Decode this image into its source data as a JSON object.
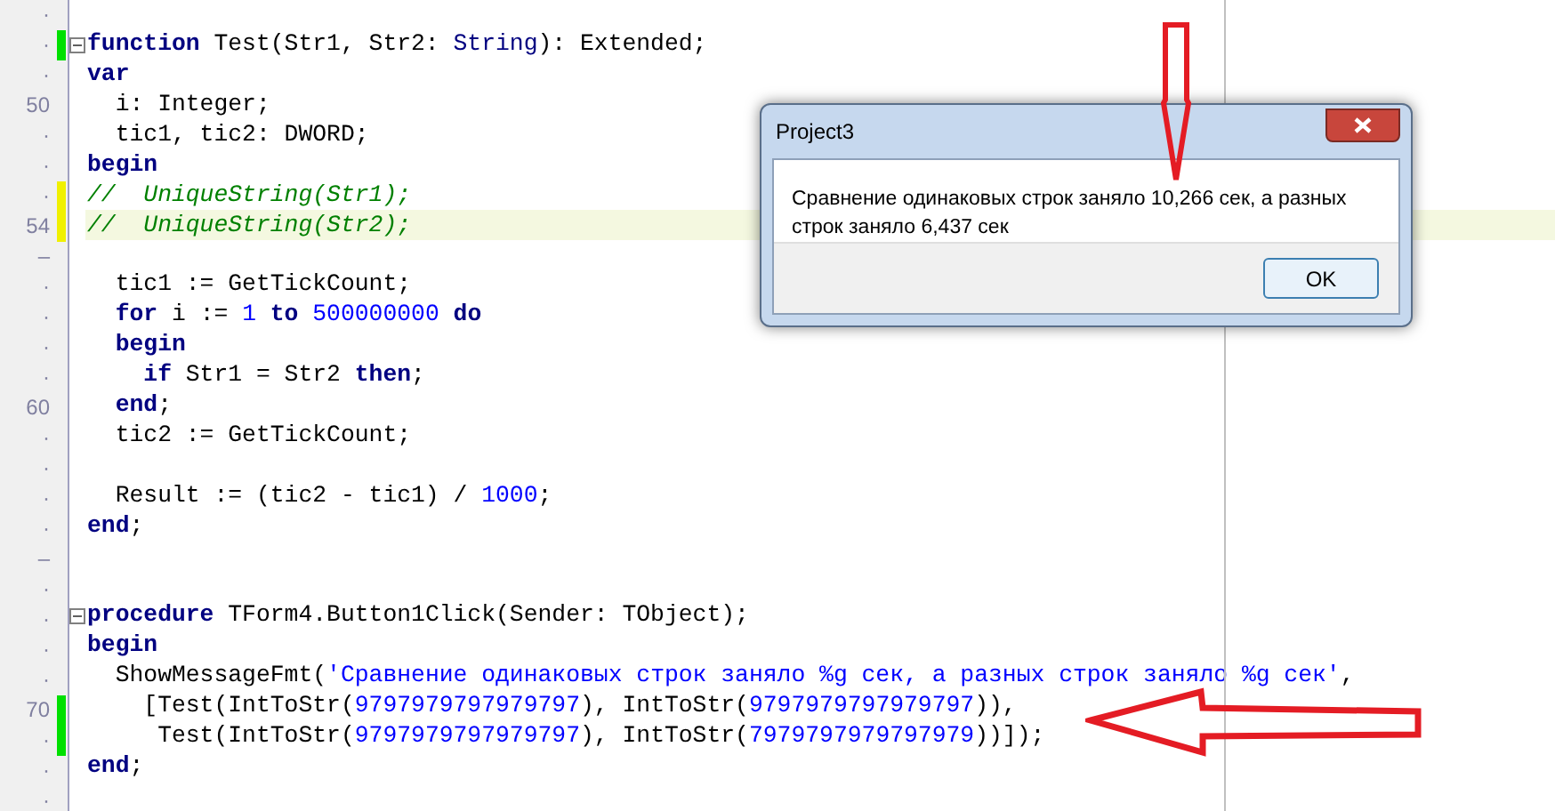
{
  "editor": {
    "lines": [
      {
        "gutter": "·",
        "fold": false,
        "current": false
      },
      {
        "gutter": "·",
        "color": "#00e000",
        "fold": true,
        "current": false,
        "tokens": [
          {
            "kind": "keyword",
            "t": "function"
          },
          {
            "kind": "plain",
            "t": " Test(Str1, Str2: "
          },
          {
            "kind": "type",
            "t": "String"
          },
          {
            "kind": "plain",
            "t": "): Extended;"
          }
        ]
      },
      {
        "gutter": "·",
        "fold": false,
        "current": false,
        "tokens": [
          {
            "kind": "keyword",
            "t": "var"
          }
        ]
      },
      {
        "gutter": "50",
        "fold": false,
        "current": false,
        "tokens": [
          {
            "kind": "plain",
            "t": "  i: Integer;"
          }
        ]
      },
      {
        "gutter": "·",
        "fold": false,
        "current": false,
        "tokens": [
          {
            "kind": "plain",
            "t": "  tic1, tic2: DWORD;"
          }
        ]
      },
      {
        "gutter": "·",
        "fold": false,
        "current": false,
        "tokens": [
          {
            "kind": "keyword",
            "t": "begin"
          }
        ]
      },
      {
        "gutter": "·",
        "color": "#f0f000",
        "fold": false,
        "current": false,
        "tokens": [
          {
            "kind": "comment",
            "t": "//  UniqueString(Str1);"
          }
        ]
      },
      {
        "gutter": "54",
        "color": "#f0f000",
        "fold": false,
        "current": true,
        "tokens": [
          {
            "kind": "comment",
            "t": "//  UniqueString(Str2);"
          }
        ]
      },
      {
        "gutter": "–",
        "fold": false,
        "current": false
      },
      {
        "gutter": "·",
        "fold": false,
        "current": false,
        "tokens": [
          {
            "kind": "plain",
            "t": "  tic1 := GetTickCount;"
          }
        ]
      },
      {
        "gutter": "·",
        "fold": false,
        "current": false,
        "tokens": [
          {
            "kind": "keyword",
            "t": "  for"
          },
          {
            "kind": "plain",
            "t": " i := "
          },
          {
            "kind": "number",
            "t": "1"
          },
          {
            "kind": "keyword",
            "t": " to "
          },
          {
            "kind": "number",
            "t": "500000000"
          },
          {
            "kind": "keyword",
            "t": " do"
          }
        ]
      },
      {
        "gutter": "·",
        "fold": false,
        "current": false,
        "tokens": [
          {
            "kind": "keyword",
            "t": "  begin"
          }
        ]
      },
      {
        "gutter": "·",
        "fold": false,
        "current": false,
        "tokens": [
          {
            "kind": "keyword",
            "t": "    if"
          },
          {
            "kind": "plain",
            "t": " Str1 = Str2 "
          },
          {
            "kind": "keyword",
            "t": "then"
          },
          {
            "kind": "plain",
            "t": ";"
          }
        ]
      },
      {
        "gutter": "60",
        "fold": false,
        "current": false,
        "tokens": [
          {
            "kind": "keyword",
            "t": "  end"
          },
          {
            "kind": "plain",
            "t": ";"
          }
        ]
      },
      {
        "gutter": "·",
        "fold": false,
        "current": false,
        "tokens": [
          {
            "kind": "plain",
            "t": "  tic2 := GetTickCount;"
          }
        ]
      },
      {
        "gutter": "·",
        "fold": false,
        "current": false
      },
      {
        "gutter": "·",
        "fold": false,
        "current": false,
        "tokens": [
          {
            "kind": "plain",
            "t": "  Result := (tic2 - tic1) / "
          },
          {
            "kind": "number",
            "t": "1000"
          },
          {
            "kind": "plain",
            "t": ";"
          }
        ]
      },
      {
        "gutter": "·",
        "fold": false,
        "current": false,
        "tokens": [
          {
            "kind": "keyword",
            "t": "end"
          },
          {
            "kind": "plain",
            "t": ";"
          }
        ]
      },
      {
        "gutter": "–",
        "fold": false,
        "current": false
      },
      {
        "gutter": "·",
        "fold": false,
        "current": false
      },
      {
        "gutter": "·",
        "fold": true,
        "current": false,
        "tokens": [
          {
            "kind": "keyword",
            "t": "procedure"
          },
          {
            "kind": "plain",
            "t": " TForm4.Button1Click(Sender: TObject);"
          }
        ]
      },
      {
        "gutter": "·",
        "fold": false,
        "current": false,
        "tokens": [
          {
            "kind": "keyword",
            "t": "begin"
          }
        ]
      },
      {
        "gutter": "·",
        "fold": false,
        "current": false,
        "tokens": [
          {
            "kind": "plain",
            "t": "  ShowMessageFmt("
          },
          {
            "kind": "string",
            "t": "'Сравнение одинаковых строк заняло %g сек, а разных строк заняло %g сек'"
          },
          {
            "kind": "plain",
            "t": ","
          }
        ]
      },
      {
        "gutter": "70",
        "color": "#00e000",
        "fold": false,
        "current": false,
        "tokens": [
          {
            "kind": "plain",
            "t": "    [Test(IntToStr("
          },
          {
            "kind": "number",
            "t": "9797979797979797"
          },
          {
            "kind": "plain",
            "t": "), IntToStr("
          },
          {
            "kind": "number",
            "t": "9797979797979797"
          },
          {
            "kind": "plain",
            "t": ")),"
          }
        ]
      },
      {
        "gutter": "·",
        "color": "#00e000",
        "fold": false,
        "current": false,
        "tokens": [
          {
            "kind": "plain",
            "t": "     Test(IntToStr("
          },
          {
            "kind": "number",
            "t": "9797979797979797"
          },
          {
            "kind": "plain",
            "t": "), IntToStr("
          },
          {
            "kind": "number",
            "t": "7979797979797979"
          },
          {
            "kind": "plain",
            "t": "))]);"
          }
        ]
      },
      {
        "gutter": "·",
        "fold": false,
        "current": false,
        "tokens": [
          {
            "kind": "keyword",
            "t": "end"
          },
          {
            "kind": "plain",
            "t": ";"
          }
        ]
      },
      {
        "gutter": "·",
        "fold": false,
        "current": false
      }
    ]
  },
  "dialog": {
    "title": "Project3",
    "message": "Сравнение одинаковых строк заняло 10,266 сек, а разных строк заняло 6,437 сек",
    "buttons": [
      "OK"
    ]
  }
}
